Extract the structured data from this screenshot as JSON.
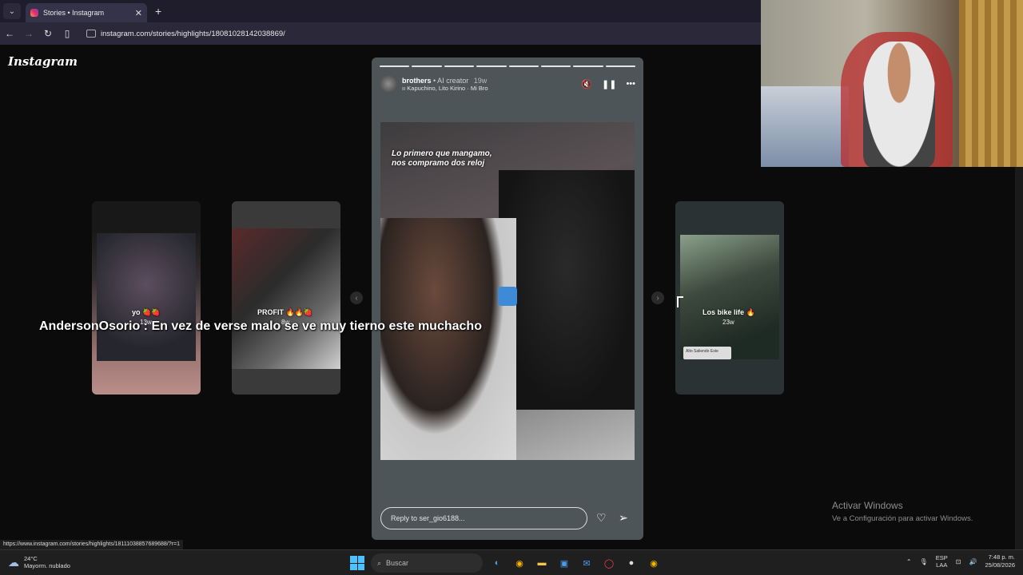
{
  "browser": {
    "tab_title": "Stories • Instagram",
    "url": "instagram.com/stories/highlights/18081028142038869/",
    "status_url": "https://www.instagram.com/stories/highlights/18111038857689688/?r=1"
  },
  "instagram": {
    "logo": "Instagram",
    "story": {
      "username": "brothers",
      "badge_text": "• AI creator",
      "age": "19w",
      "music": "Kapuchino, Lito Kirino · Mi Bro",
      "photo_text_line1": "Lo primero que mangamo,",
      "photo_text_line2": "nos compramo dos reloj",
      "reply_placeholder": "Reply to ser_gio6188..."
    },
    "side_cards": [
      {
        "label": "yo 🍓🍓",
        "age": "13w"
      },
      {
        "label": "PROFIT 🔥🔥🍓",
        "age": "8w"
      },
      {
        "label": "Los bike life 🔥",
        "age": "23w",
        "chip": "Alto Saliendo Este"
      }
    ]
  },
  "overlay_comment": "AndersonOsorio : En vez de verse malo se ve muy tierno este muchacho",
  "watermark": {
    "title": "Activar Windows",
    "subtitle": "Ve a Configuración para activar Windows."
  },
  "taskbar": {
    "weather_temp": "24°C",
    "weather_desc": "Mayorm. nublado",
    "search_placeholder": "Buscar",
    "lang_line1": "ESP",
    "lang_line2": "LAA",
    "time": "7:48 p. m.",
    "date": "25/08/2026"
  },
  "colors": {
    "accent_blue": "#4cc2ff",
    "story_bg": "#4e5559"
  }
}
